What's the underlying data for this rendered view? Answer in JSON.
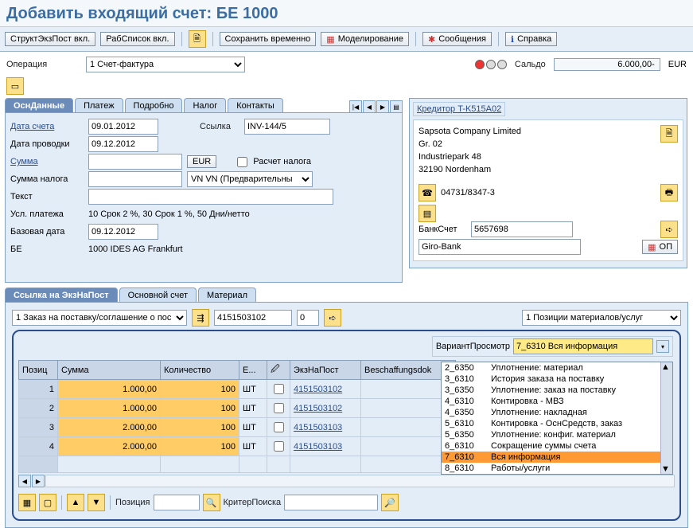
{
  "title": "Добавить входящий счет: БЕ 1000",
  "toolbar": {
    "struct_btn": "СтруктЭкзПост вкл.",
    "worklist_btn": "РабСписок вкл.",
    "save_temp": "Сохранить временно",
    "simulate": "Моделирование",
    "messages": "Сообщения",
    "help": "Справка"
  },
  "header": {
    "operation_label": "Операция",
    "operation_value": "1 Счет-фактура",
    "balance_label": "Сальдо",
    "balance_value": "6.000,00-",
    "balance_curr": "EUR"
  },
  "tabs": [
    "ОснДанные",
    "Платеж",
    "Подробно",
    "Налог",
    "Контакты"
  ],
  "basic": {
    "date_inv_label": "Дата счета",
    "date_inv": "09.01.2012",
    "post_date_label": "Дата проводки",
    "post_date": "09.12.2012",
    "ref_label": "Ссылка",
    "ref": "INV-144/5",
    "amount_label": "Сумма",
    "amount": "",
    "curr_btn": "EUR",
    "tax_calc_label": "Расчет налога",
    "tax_amt_label": "Сумма налога",
    "tax_code": "VN VN (Предварительны",
    "text_label": "Текст",
    "payterm_label": "Усл. платежа",
    "payterm": "10 Срок 2 %, 30 Срок 1 %, 50 Дни/нетто",
    "baseline_label": "Базовая дата",
    "baseline": "09.12.2012",
    "cc_label": "БЕ",
    "cc": "1000 IDES AG Frankfurt"
  },
  "vendor": {
    "title": "Кредитор",
    "code": "T-K515A02",
    "name": "Sapsota Company Limited",
    "group": "Gr. 02",
    "street": "Industriepark 48",
    "city": "32190 Nordenham",
    "phone": "04731/8347-3",
    "bankacct_label": "БанкСчет",
    "bankacct": "5657698",
    "bankname": "Giro-Bank",
    "openitems": "ОП"
  },
  "section_tabs": [
    "Ссылка на ЭкзНаПост",
    "Основной счет",
    "Материал"
  ],
  "ref_row": {
    "type": "1 Заказ на поставку/соглашение о пос",
    "po": "4151503102",
    "item": "0",
    "layout_label": "1 Позиции материалов/услуг"
  },
  "variant": {
    "label": "ВариантПросмотр",
    "value": "7_6310 Вся информация"
  },
  "grid": {
    "cols": [
      "Позиц",
      "Сумма",
      "Количество",
      "Е...",
      "",
      "ЭкзНаПост",
      "Beschaffungsdok"
    ],
    "rows": [
      {
        "pos": "1",
        "amount": "1.000,00",
        "qty": "100",
        "uom": "ШТ",
        "po": "4151503102"
      },
      {
        "pos": "2",
        "amount": "1.000,00",
        "qty": "100",
        "uom": "ШТ",
        "po": "4151503102"
      },
      {
        "pos": "3",
        "amount": "2.000,00",
        "qty": "100",
        "uom": "ШТ",
        "po": "4151503103"
      },
      {
        "pos": "4",
        "amount": "2.000,00",
        "qty": "100",
        "uom": "ШТ",
        "po": "4151503103"
      }
    ]
  },
  "dropdown": [
    {
      "code": "2_6350",
      "text": "Уплотнение: материал"
    },
    {
      "code": "3_6310",
      "text": "История заказа на поставку"
    },
    {
      "code": "3_6350",
      "text": "Уплотнение: заказ на поставку"
    },
    {
      "code": "4_6310",
      "text": "Контировка - МВЗ"
    },
    {
      "code": "4_6350",
      "text": "Уплотнение: накладная"
    },
    {
      "code": "5_6310",
      "text": "Контировка - ОснСредств, заказ"
    },
    {
      "code": "5_6350",
      "text": "Уплотнение: конфиг. материал"
    },
    {
      "code": "6_6310",
      "text": "Сокращение суммы счета"
    },
    {
      "code": "7_6310",
      "text": "Вся информация",
      "selected": true
    },
    {
      "code": "8_6310",
      "text": "Работы/услуги"
    }
  ],
  "bottom": {
    "pos_label": "Позиция",
    "search_label": "КритерПоиска"
  }
}
